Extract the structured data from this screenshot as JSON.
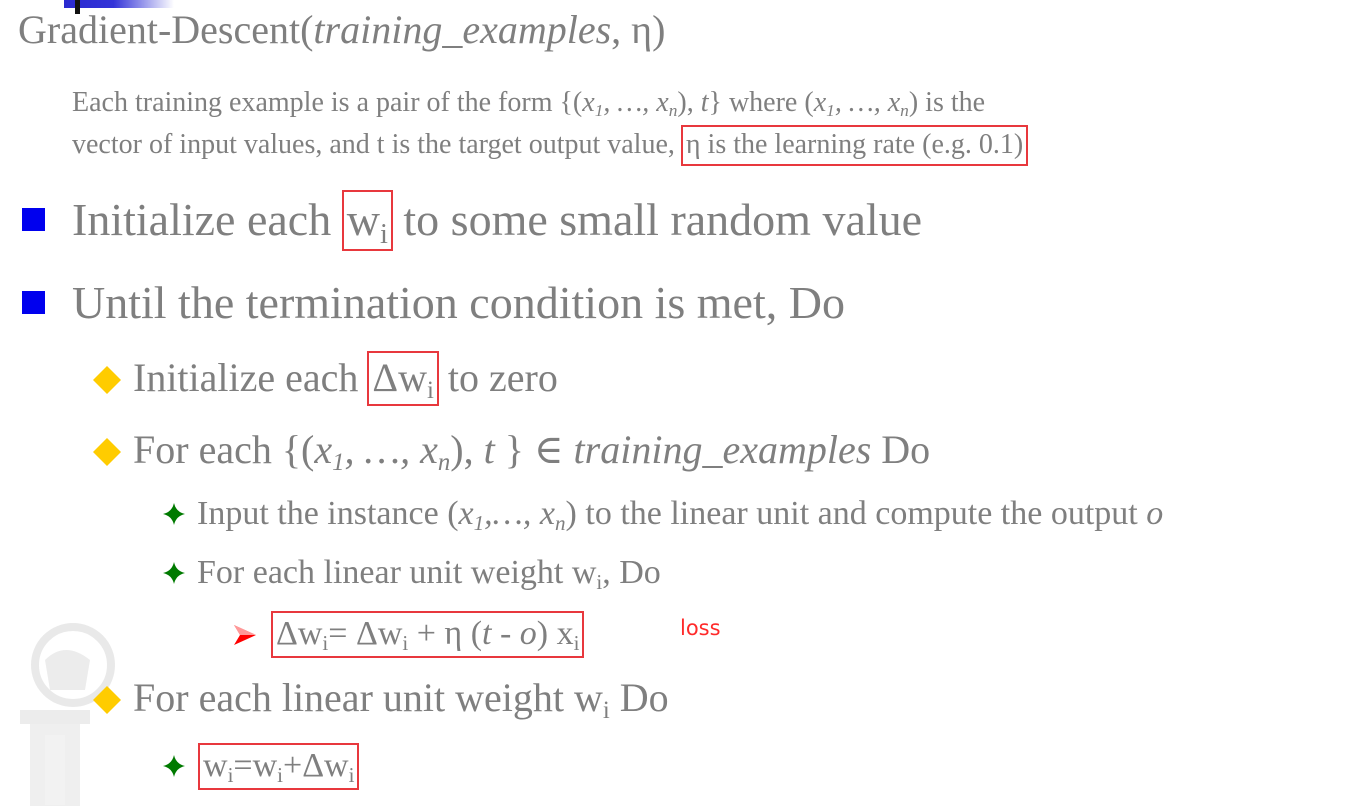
{
  "title": [
    {
      "t": "Gradient-Descent("
    },
    {
      "t": "training_examples",
      "s": "i"
    },
    {
      "t": ", η)"
    }
  ],
  "description": {
    "line1": [
      {
        "t": "Each training example is a pair of the form {("
      },
      {
        "t": "x",
        "s": "i"
      },
      {
        "t": "1",
        "s": "isub"
      },
      {
        "t": ", …, ",
        "s": "i"
      },
      {
        "t": "x",
        "s": "i"
      },
      {
        "t": "n",
        "s": "isub"
      },
      {
        "t": "), "
      },
      {
        "t": "t",
        "s": "i"
      },
      {
        "t": "} where ("
      },
      {
        "t": "x",
        "s": "i"
      },
      {
        "t": "1",
        "s": "isub"
      },
      {
        "t": ", …, ",
        "s": "i"
      },
      {
        "t": "x",
        "s": "i"
      },
      {
        "t": "n",
        "s": "isub"
      },
      {
        "t": ") is the"
      }
    ],
    "line2": [
      {
        "t": "vector of input values, and t is the target output value, "
      },
      {
        "box": [
          {
            "t": "η is the learning rate (e.g. 0.1)"
          }
        ]
      }
    ]
  },
  "steps": [
    {
      "level": 1,
      "parts": [
        {
          "t": "Initialize each "
        },
        {
          "box": [
            {
              "t": "w"
            },
            {
              "t": "i",
              "s": "sub"
            }
          ]
        },
        {
          "t": " to some small random value"
        }
      ]
    },
    {
      "level": 1,
      "parts": [
        {
          "t": "Until the termination condition is met, Do"
        }
      ]
    },
    {
      "level": 2,
      "parts": [
        {
          "t": "Initialize each "
        },
        {
          "box": [
            {
              "t": "Δw"
            },
            {
              "t": "i",
              "s": "sub"
            }
          ]
        },
        {
          "t": " to zero"
        }
      ]
    },
    {
      "level": 2,
      "parts": [
        {
          "t": "For each {("
        },
        {
          "t": "x",
          "s": "i"
        },
        {
          "t": "1",
          "s": "isub"
        },
        {
          "t": ", …, ",
          "s": "i"
        },
        {
          "t": "x",
          "s": "i"
        },
        {
          "t": "n",
          "s": "isub"
        },
        {
          "t": "), "
        },
        {
          "t": "t",
          "s": "i"
        },
        {
          "t": " } ∈ "
        },
        {
          "t": "training_examples",
          "s": "i"
        },
        {
          "t": " Do"
        }
      ]
    },
    {
      "level": 3,
      "parts": [
        {
          "t": "Input the instance ("
        },
        {
          "t": "x",
          "s": "i"
        },
        {
          "t": "1",
          "s": "isub"
        },
        {
          "t": ",…, ",
          "s": "i"
        },
        {
          "t": "x",
          "s": "i"
        },
        {
          "t": "n",
          "s": "isub"
        },
        {
          "t": ") to the linear unit and compute the output "
        },
        {
          "t": "o",
          "s": "i"
        }
      ]
    },
    {
      "level": 3,
      "parts": [
        {
          "t": "For each linear unit weight w"
        },
        {
          "t": "i",
          "s": "sub"
        },
        {
          "t": ", Do"
        }
      ]
    },
    {
      "level": 4,
      "parts": [
        {
          "box": [
            {
              "t": "Δw"
            },
            {
              "t": "i",
              "s": "sub"
            },
            {
              "t": "= Δw"
            },
            {
              "t": "i",
              "s": "sub"
            },
            {
              "t": " + η ("
            },
            {
              "t": "t",
              "s": "i"
            },
            {
              "t": " - "
            },
            {
              "t": "o",
              "s": "i"
            },
            {
              "t": ") x"
            },
            {
              "t": "i",
              "s": "sub"
            }
          ]
        }
      ]
    },
    {
      "level": 2,
      "parts": [
        {
          "t": "For each linear unit weight w"
        },
        {
          "t": "i",
          "s": "sub"
        },
        {
          "t": " Do"
        }
      ]
    },
    {
      "level": 3,
      "parts": [
        {
          "box": [
            {
              "t": "w"
            },
            {
              "t": "i",
              "s": "sub"
            },
            {
              "t": "=w"
            },
            {
              "t": "i",
              "s": "sub"
            },
            {
              "t": "+Δw"
            },
            {
              "t": "i",
              "s": "sub"
            }
          ]
        }
      ]
    }
  ],
  "annotation": "loss",
  "colors": {
    "text": "#7f7f7f",
    "highlight_box": "#e8383d",
    "bullet_square": "#0000ee",
    "bullet_diamond": "#ffcc00",
    "bullet_star": "#007a00",
    "bullet_arrow": "#ff0000",
    "annotation": "#ff2a2a"
  },
  "icons": {
    "level1": "blue-square-bullet",
    "level2": "yellow-diamond-bullet",
    "level3": "green-star-bullet",
    "level4": "red-arrow-bullet"
  }
}
